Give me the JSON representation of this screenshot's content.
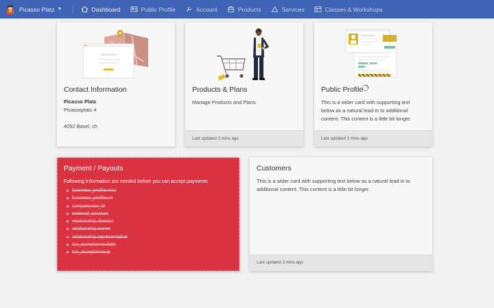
{
  "nav": {
    "brand": "Picasso Platz",
    "items": [
      {
        "label": "Dashboard",
        "icon": "home-icon",
        "active": true
      },
      {
        "label": "Public Profile",
        "icon": "profile-card-icon",
        "active": false
      },
      {
        "label": "Account",
        "icon": "wrench-icon",
        "active": false
      },
      {
        "label": "Products",
        "icon": "products-icon",
        "active": false
      },
      {
        "label": "Services",
        "icon": "services-icon",
        "active": false
      },
      {
        "label": "Classes & Workshops",
        "icon": "classes-icon",
        "active": false
      }
    ]
  },
  "cards": {
    "contact": {
      "title": "Contact Information",
      "name": "Picasso Platz",
      "street": "Picassoplatz 4",
      "city": "4052 Basel, ch"
    },
    "products": {
      "title": "Products & Plans",
      "text": "Manage Products and Plans",
      "footer": "Last updated 3 mins ago"
    },
    "profile": {
      "title": "Public Profile",
      "text": [
        "This is a wider card with supporting text",
        "below as a natural lead-in to additional",
        "content. This content is a little bit longer."
      ],
      "footer": "Last updated 3 mins ago"
    },
    "payment": {
      "title": "Payment / Payouts",
      "intro": "Following Information are needed before you can accept payments",
      "items": [
        "business_profile.mcc",
        "business_profile.url",
        "company.tax_id",
        "external_account",
        "relationship.director",
        "relationship.owner",
        "relationship.representative",
        "tos_acceptance.date",
        "tos_acceptance.ip"
      ]
    },
    "customers": {
      "title": "Customers",
      "text": [
        "This is a wider card with supporting text below as a natural lead-in to",
        "additional content. This content is a little bit longer."
      ],
      "footer": "Last updated 3 mins ago"
    }
  },
  "colors": {
    "navbar": "#3f63b5",
    "payment_card": "#d93240",
    "page_background": "#f1f1f1"
  }
}
